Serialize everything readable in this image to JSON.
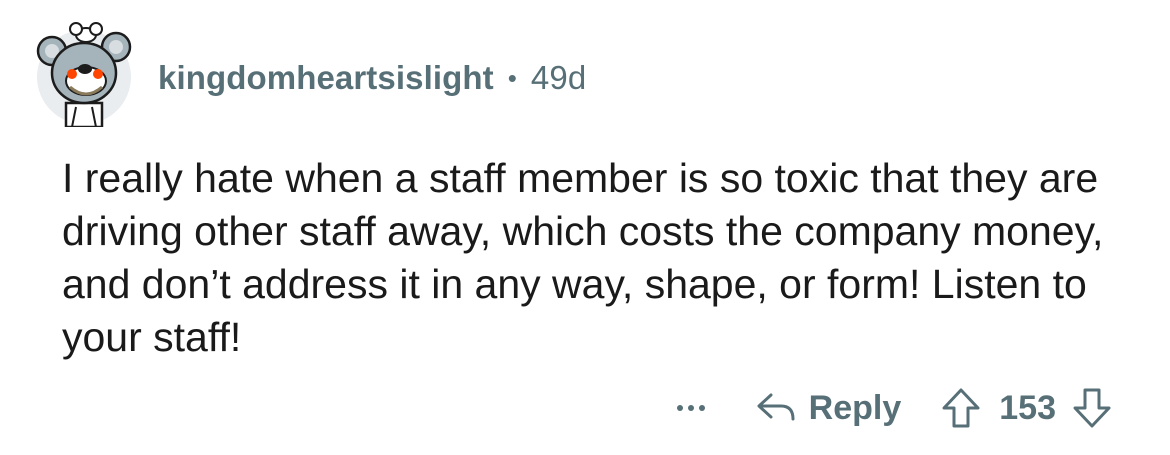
{
  "comment": {
    "username": "kingdomheartsislight",
    "separator": "•",
    "age": "49d",
    "text": "I really hate when a staff member is so toxic that they are driving other staff away, which costs the company money, and don’t address it in any way, shape, or form! Listen to your staff!",
    "actions": {
      "reply_label": "Reply",
      "score": "153"
    }
  },
  "colors": {
    "meta_text": "#576f76",
    "body_text": "#1a1a1b",
    "avatar_bg": "#e9edef",
    "avatar_mouse": "#a5b3bb",
    "avatar_eyes": "#ff4500"
  },
  "icons": {
    "avatar": "koala-snoo-avatar",
    "more": "more-options-icon",
    "reply": "reply-arrow-icon",
    "upvote": "upvote-arrow-icon",
    "downvote": "downvote-arrow-icon"
  }
}
